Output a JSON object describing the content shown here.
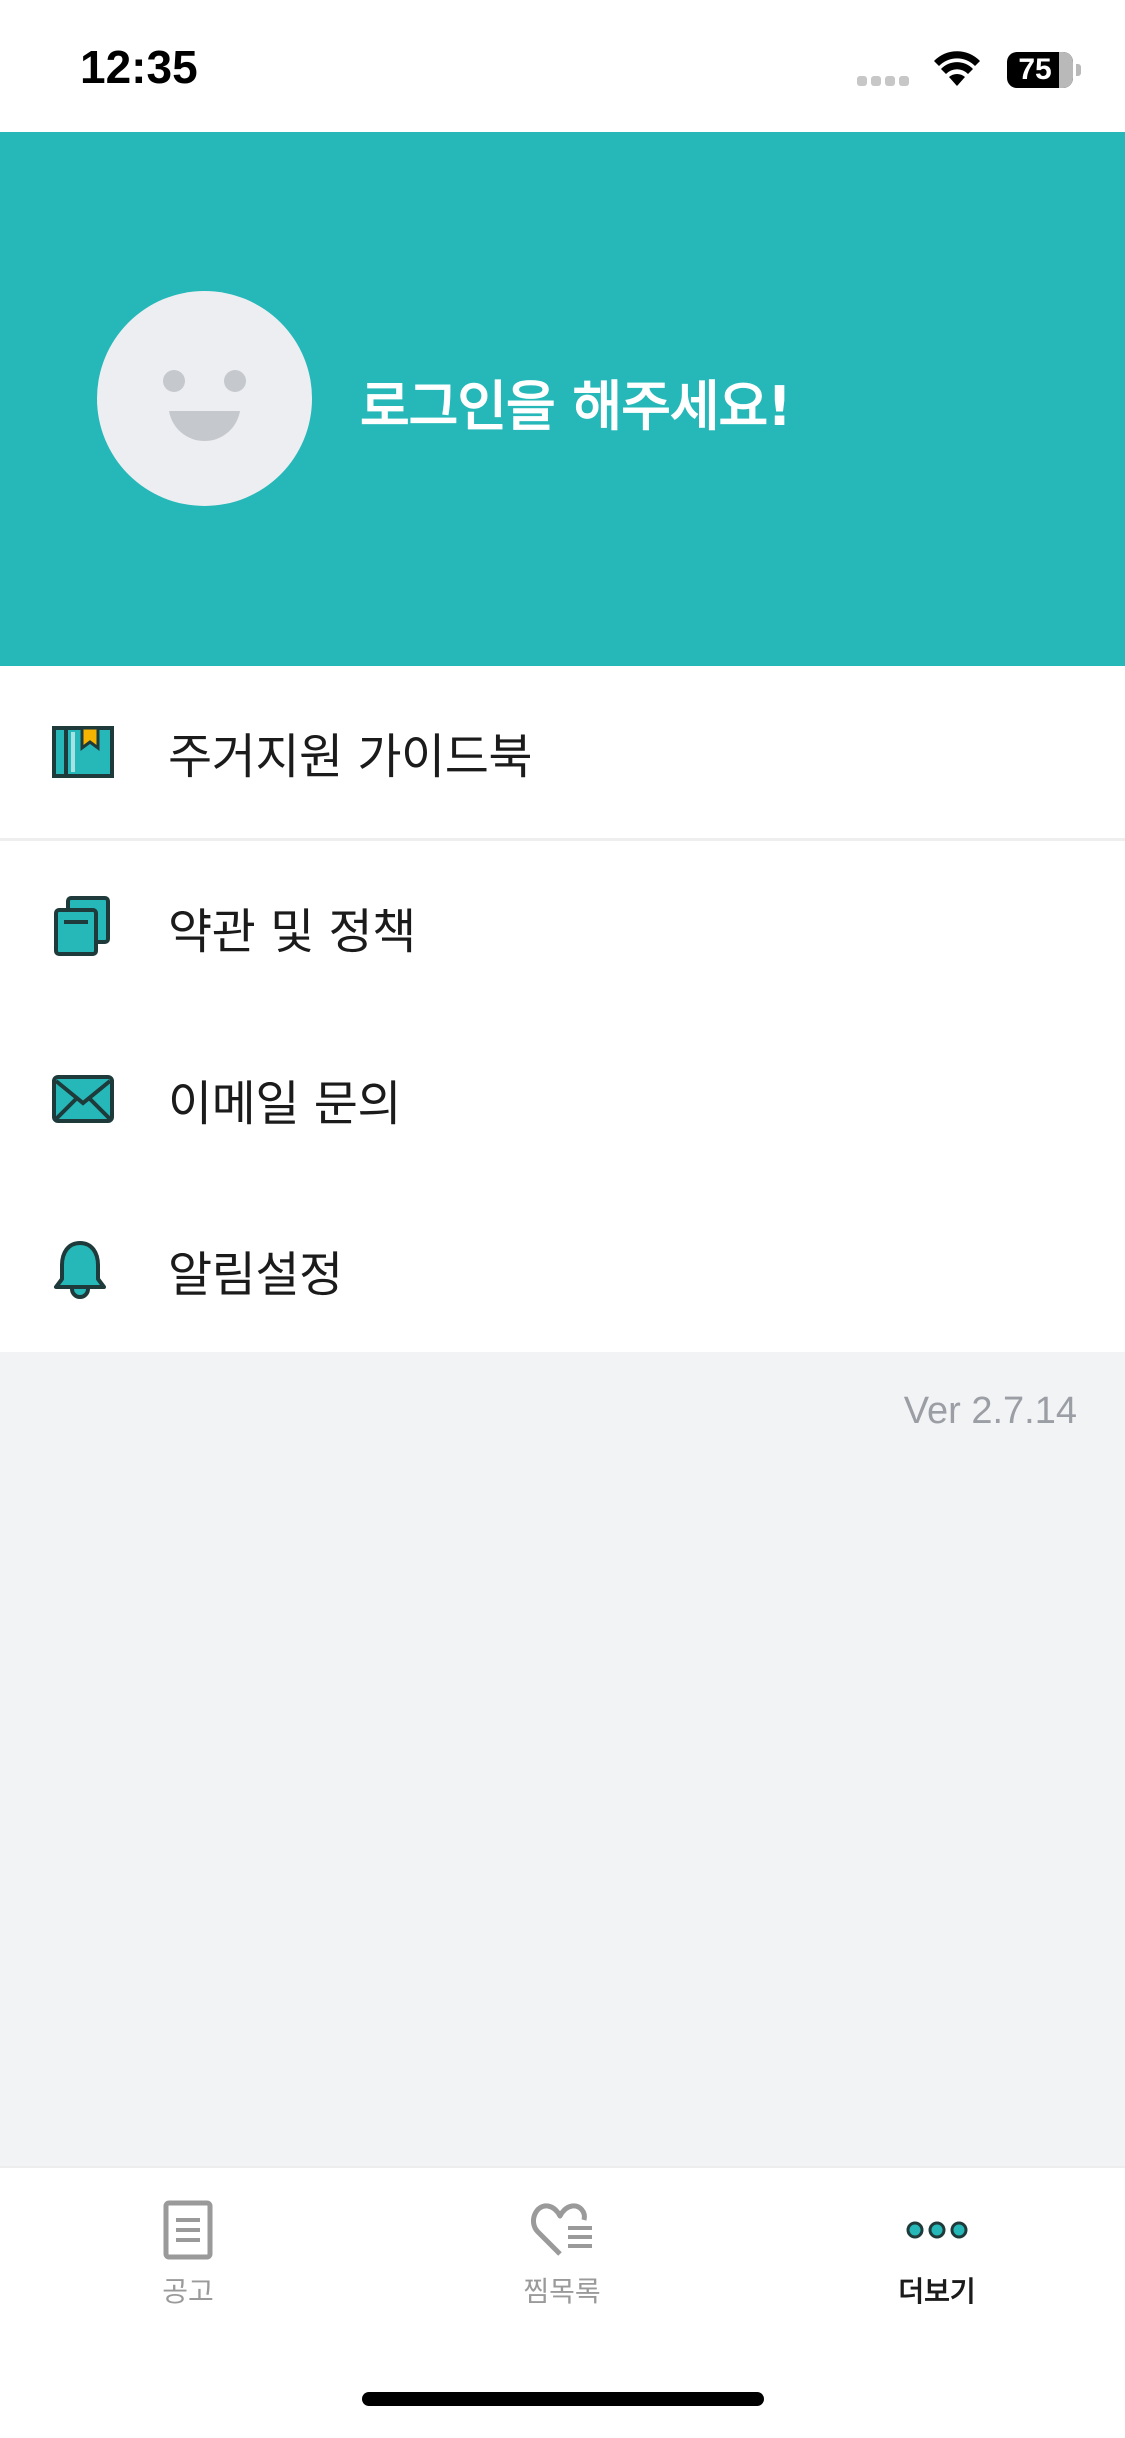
{
  "status_bar": {
    "time": "12:35",
    "battery_level": "75",
    "icons": [
      "signal-icon",
      "wifi-icon",
      "battery-icon"
    ]
  },
  "header": {
    "login_prompt": "로그인을 해주세요!",
    "background_color": "#26b8b8",
    "avatar_icon": "smiley-avatar-icon"
  },
  "menu": {
    "items": [
      {
        "label": "주거지원 가이드북",
        "icon": "guidebook-icon"
      },
      {
        "label": "약관 및 정책",
        "icon": "documents-icon"
      },
      {
        "label": "이메일 문의",
        "icon": "envelope-icon"
      },
      {
        "label": "알림설정",
        "icon": "bell-icon"
      }
    ]
  },
  "version": "Ver 2.7.14",
  "tabbar": {
    "tabs": [
      {
        "label": "공고",
        "icon": "document-list-icon",
        "active": false
      },
      {
        "label": "찜목록",
        "icon": "heart-list-icon",
        "active": false
      },
      {
        "label": "더보기",
        "icon": "more-dots-icon",
        "active": true
      }
    ]
  },
  "colors": {
    "accent": "#26b8b8",
    "icon_dark": "#1f3a3a",
    "bookmark": "#f5b400",
    "inactive_tab": "#9a9a9a",
    "background": "#f2f3f5"
  }
}
